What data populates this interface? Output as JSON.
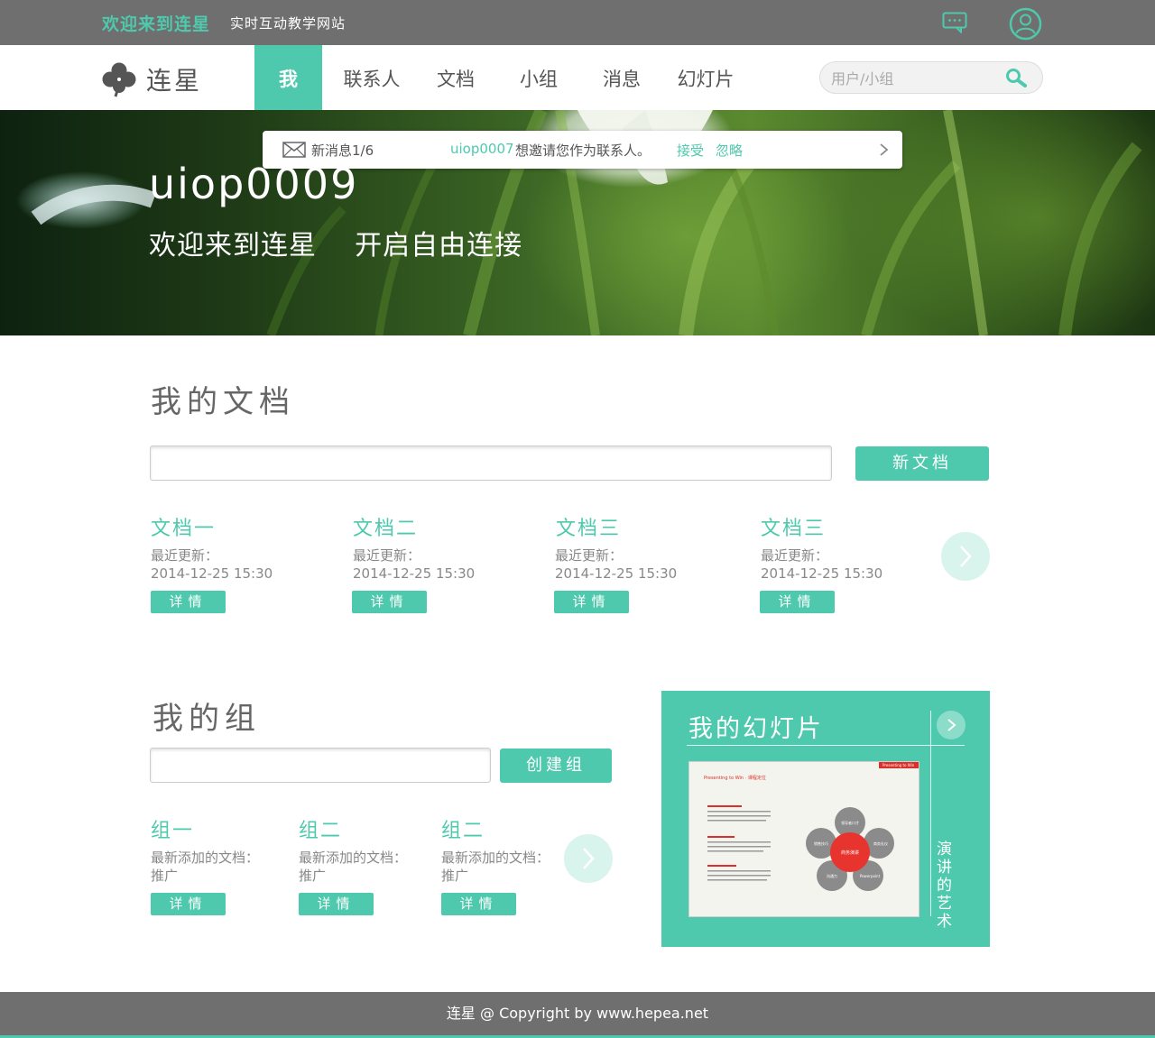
{
  "topbar": {
    "brand": "欢迎来到连星",
    "tagline": "实时互动教学网站",
    "chat_icon": "chat-bubble-icon",
    "user_icon": "user-profile-icon"
  },
  "nav": {
    "logo_text": "连星",
    "items": [
      {
        "label": "我",
        "active": true
      },
      {
        "label": "联系人",
        "active": false
      },
      {
        "label": "文档",
        "active": false
      },
      {
        "label": "小组",
        "active": false
      },
      {
        "label": "消息",
        "active": false
      },
      {
        "label": "幻灯片",
        "active": false
      }
    ],
    "search_placeholder": "用户/小组"
  },
  "banner": {
    "username": "uiop0009",
    "welcome": "欢迎来到连星    开启自由连接",
    "notice": {
      "count": "新消息1/6",
      "from_user": "uiop0007",
      "message": "想邀请您作为联系人。",
      "accept": "接受",
      "ignore": "忽略"
    }
  },
  "documents": {
    "title": "我的文档",
    "new_button": "新文档",
    "items": [
      {
        "title": "文档一",
        "updated_label": "最近更新：",
        "updated": "2014-12-25 15:30",
        "detail": "详情"
      },
      {
        "title": "文档二",
        "updated_label": "最近更新：",
        "updated": "2014-12-25 15:30",
        "detail": "详情"
      },
      {
        "title": "文档三",
        "updated_label": "最近更新：",
        "updated": "2014-12-25 15:30",
        "detail": "详情"
      },
      {
        "title": "文档三",
        "updated_label": "最近更新：",
        "updated": "2014-12-25 15:30",
        "detail": "详情"
      }
    ]
  },
  "groups": {
    "title": "我的组",
    "create_button": "创建组",
    "items": [
      {
        "title": "组一",
        "latest_label": "最新添加的文档：",
        "latest": "推广",
        "detail": "详情"
      },
      {
        "title": "组二",
        "latest_label": "最新添加的文档：",
        "latest": "推广",
        "detail": "详情"
      },
      {
        "title": "组二",
        "latest_label": "最新添加的文档：",
        "latest": "推广",
        "detail": "详情"
      }
    ]
  },
  "slides": {
    "title": "我的幻灯片",
    "caption": "演讲的艺术",
    "thumb": {
      "heading": "Presenting to Win · 课程定位",
      "tag": "Presenting to Win",
      "center": "商务演讲",
      "petals": [
        "领导者口才",
        "商务礼仪",
        "Powerpoint",
        "沟通力",
        "销售技巧"
      ]
    }
  },
  "footer": {
    "text": "连星 @ Copyright by www.hepea.net"
  },
  "colors": {
    "accent": "#4ec9ad",
    "bar": "#6f6f6f",
    "text": "#555555"
  }
}
